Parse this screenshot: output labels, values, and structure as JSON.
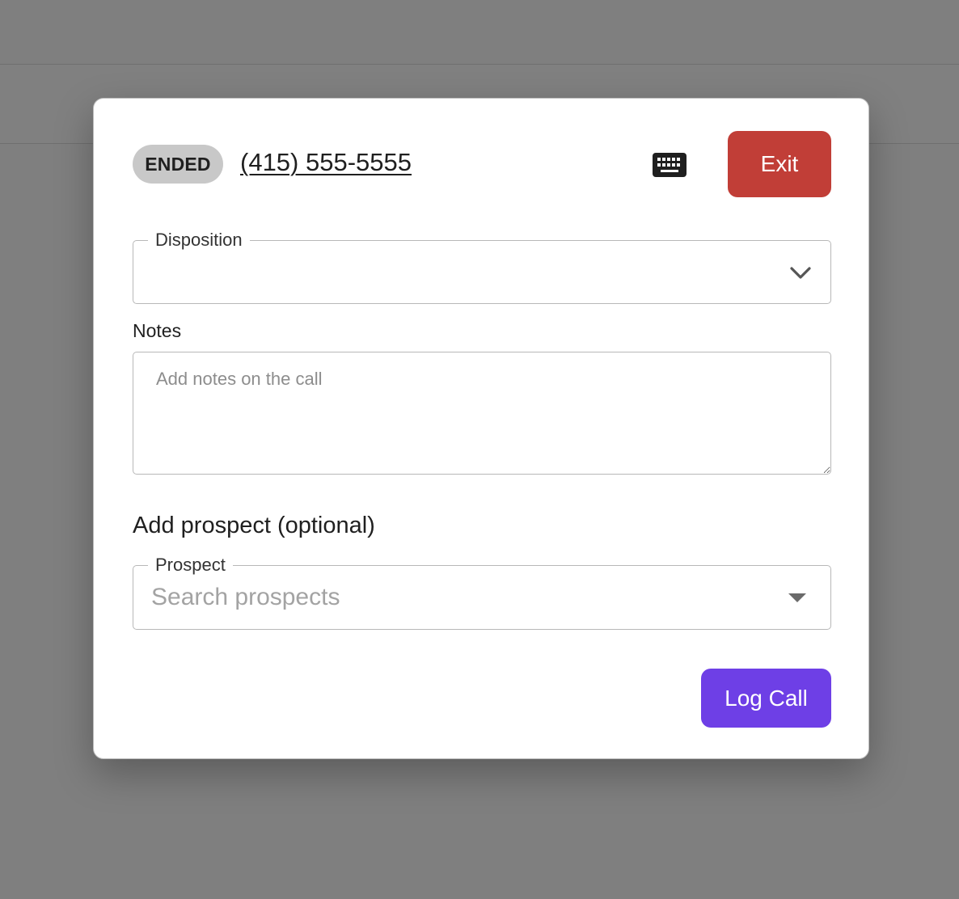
{
  "call": {
    "status": "ENDED",
    "phone_number": "(415) 555-5555"
  },
  "toolbar": {
    "keypad_icon": "keyboard-icon",
    "exit_label": "Exit"
  },
  "disposition": {
    "label": "Disposition",
    "value": "",
    "icon": "chevron-down-icon"
  },
  "notes": {
    "label": "Notes",
    "value": "",
    "placeholder": "Add notes on the call"
  },
  "prospect_section": {
    "title": "Add prospect (optional)",
    "field_label": "Prospect",
    "placeholder": "Search prospects",
    "value": "",
    "icon": "caret-down-icon"
  },
  "actions": {
    "log_call_label": "Log Call"
  },
  "colors": {
    "exit_button": "#c13e37",
    "log_call_button": "#6e3fe6",
    "status_pill": "#c8c8c8",
    "overlay": "#7f7f7f"
  }
}
